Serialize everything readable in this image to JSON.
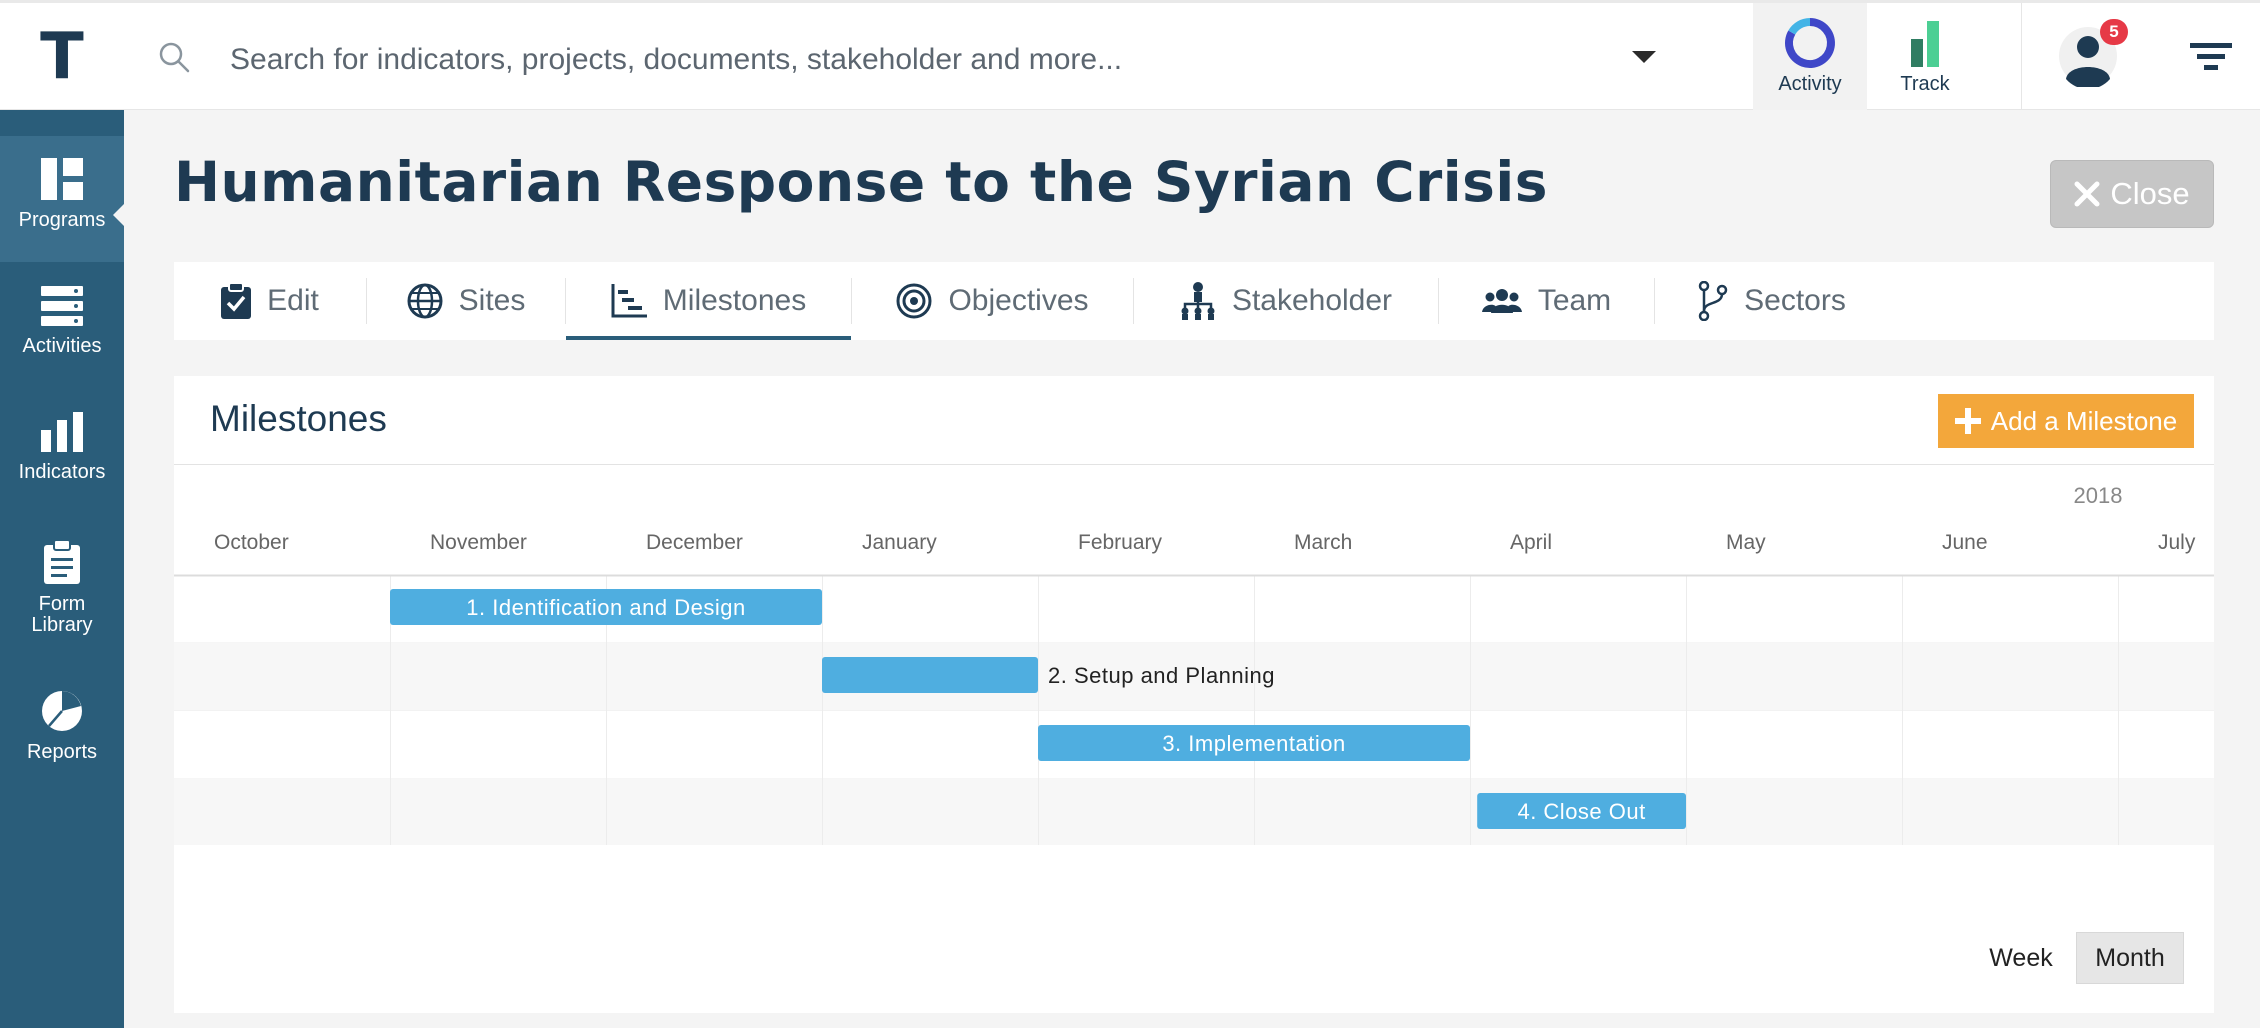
{
  "app": {
    "logo_letter": "T"
  },
  "search": {
    "placeholder": "Search for indicators, projects, documents, stakeholder and more..."
  },
  "top_nav": [
    {
      "label": "Activity",
      "icon": "activity-ring-icon"
    },
    {
      "label": "Track",
      "icon": "track-bars-icon"
    }
  ],
  "notifications": {
    "count": "5"
  },
  "sidebar": {
    "items": [
      {
        "label": "Programs",
        "icon": "programs-icon",
        "active": true
      },
      {
        "label": "Activities",
        "icon": "activities-icon"
      },
      {
        "label": "Indicators",
        "icon": "indicators-icon"
      },
      {
        "label": "Form Library",
        "icon": "form-library-icon"
      },
      {
        "label": "Reports",
        "icon": "reports-icon"
      }
    ]
  },
  "page": {
    "title": "Humanitarian Response to the Syrian Crisis",
    "close_label": "Close"
  },
  "tabs": [
    {
      "label": "Edit",
      "icon": "clipboard-check-icon"
    },
    {
      "label": "Sites",
      "icon": "globe-icon"
    },
    {
      "label": "Milestones",
      "icon": "gantt-icon",
      "active": true
    },
    {
      "label": "Objectives",
      "icon": "target-icon"
    },
    {
      "label": "Stakeholder",
      "icon": "org-chart-icon"
    },
    {
      "label": "Team",
      "icon": "users-icon"
    },
    {
      "label": "Sectors",
      "icon": "branch-icon"
    }
  ],
  "milestones": {
    "title": "Milestones",
    "add_label": "Add a Milestone",
    "year_label": "2018",
    "months": [
      "October",
      "November",
      "December",
      "January",
      "February",
      "March",
      "April",
      "May",
      "June",
      "July"
    ],
    "tasks": [
      {
        "label": "1. Identification and Design",
        "start": "2017-11-01",
        "end": "2018-01-01",
        "label_inside": true
      },
      {
        "label": "2. Setup and Planning",
        "start": "2018-01-01",
        "end": "2018-02-01",
        "label_inside": false
      },
      {
        "label": "3. Implementation",
        "start": "2018-02-01",
        "end": "2018-04-01",
        "label_inside": true
      },
      {
        "label": "4. Close Out",
        "start": "2018-04-02",
        "end": "2018-05-01",
        "label_inside": true
      }
    ],
    "bar_color": "#4faee0",
    "view_modes": {
      "week": "Week",
      "month": "Month",
      "selected": "Month"
    }
  }
}
